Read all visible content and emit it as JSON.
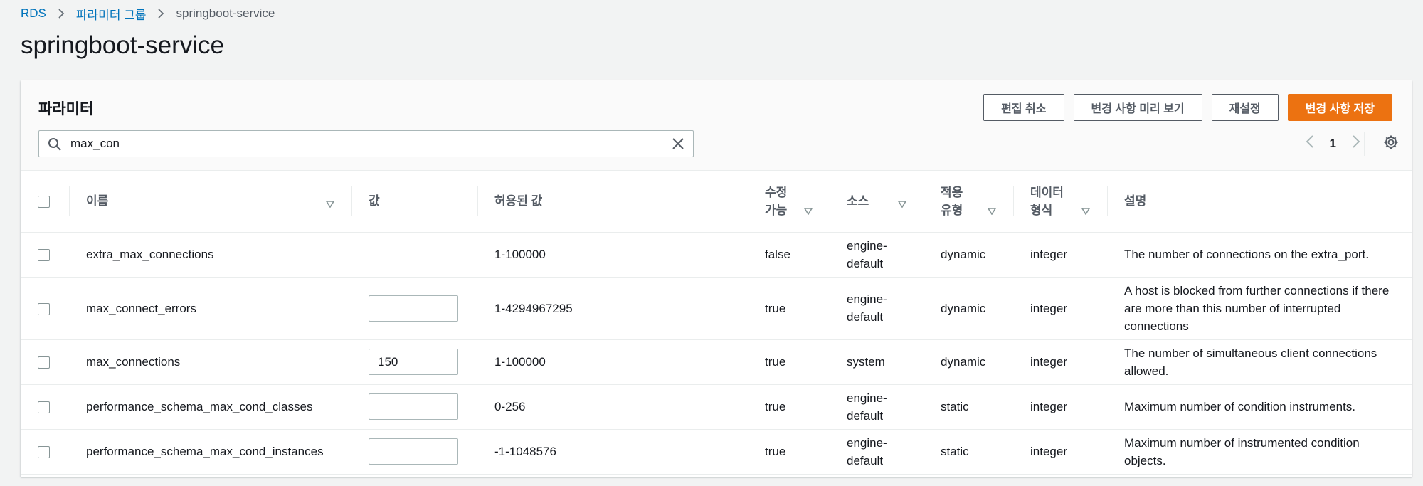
{
  "breadcrumb": {
    "root": "RDS",
    "parent": "파라미터 그룹",
    "current": "springboot-service"
  },
  "page_title": "springboot-service",
  "panel": {
    "title": "파라미터",
    "buttons": {
      "cancel": "편집 취소",
      "preview": "변경 사항 미리 보기",
      "reset": "재설정",
      "save": "변경 사항 저장"
    },
    "search": {
      "value": "max_con"
    },
    "pager": {
      "current_page": "1"
    }
  },
  "columns": {
    "name": "이름",
    "value": "값",
    "allowed": "허용된 값",
    "modifiable_1": "수정",
    "modifiable_2": "가능",
    "source": "소스",
    "apply_1": "적용",
    "apply_2": "유형",
    "datatype_1": "데이터",
    "datatype_2": "형식",
    "description": "설명"
  },
  "rows": [
    {
      "name": "extra_max_connections",
      "value": "",
      "allowed": "1-100000",
      "modifiable": "false",
      "source_1": "engine-",
      "source_2": "default",
      "apply": "dynamic",
      "datatype": "integer",
      "description": "The number of connections on the extra_port."
    },
    {
      "name": "max_connect_errors",
      "value": "",
      "allowed": "1-4294967295",
      "modifiable": "true",
      "source_1": "engine-",
      "source_2": "default",
      "apply": "dynamic",
      "datatype": "integer",
      "description": "A host is blocked from further connections if there are more than this number of interrupted connections"
    },
    {
      "name": "max_connections",
      "value": "150",
      "allowed": "1-100000",
      "modifiable": "true",
      "source_1": "system",
      "source_2": "",
      "apply": "dynamic",
      "datatype": "integer",
      "description": "The number of simultaneous client connections allowed."
    },
    {
      "name": "performance_schema_max_cond_classes",
      "value": "",
      "allowed": "0-256",
      "modifiable": "true",
      "source_1": "engine-",
      "source_2": "default",
      "apply": "static",
      "datatype": "integer",
      "description": "Maximum number of condition instruments."
    },
    {
      "name": "performance_schema_max_cond_instances",
      "value": "",
      "allowed": "-1-1048576",
      "modifiable": "true",
      "source_1": "engine-",
      "source_2": "default",
      "apply": "static",
      "datatype": "integer",
      "description": "Maximum number of instrumented condition objects."
    }
  ],
  "colors": {
    "link": "#0073bb",
    "primary": "#ec7211",
    "text": "#16191f",
    "muted": "#545b64"
  },
  "icons": [
    "chevron-right-icon",
    "search-icon",
    "close-icon",
    "chevron-left-icon",
    "gear-icon",
    "sort-down-icon"
  ]
}
